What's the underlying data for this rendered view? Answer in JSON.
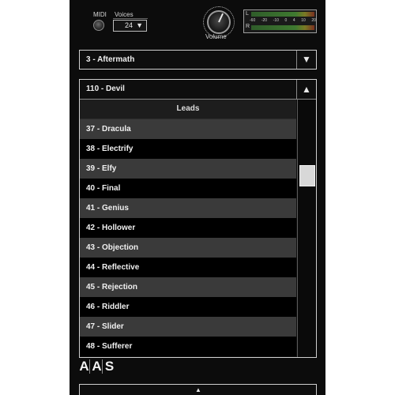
{
  "header": {
    "midi_label": "MIDI",
    "voices_label": "Voices",
    "voices_value": "24",
    "volume_label": "Volume",
    "meter": {
      "left_label": "L",
      "right_label": "R",
      "scale": [
        "-60",
        "-20",
        "-10",
        "0",
        "4",
        "10",
        "20"
      ]
    }
  },
  "bank_select": {
    "value": "3 - Aftermath",
    "arrow_icon": "triangle-down-icon"
  },
  "preset_select": {
    "value": "110 - Devil",
    "arrow_icon": "triangle-up-icon",
    "category": "Leads",
    "items": [
      "37 - Dracula",
      "38 - Electrify",
      "39 - Elfy",
      "40 - Final",
      "41 - Genius",
      "42 - Hollower",
      "43 - Objection",
      "44 - Reflective",
      "45 - Rejection",
      "46 - Riddler",
      "47 - Slider",
      "48 - Sufferer"
    ]
  },
  "logo": {
    "letters": [
      "A",
      "A",
      "S"
    ]
  },
  "colors": {
    "panel_bg": "#0c0c0c",
    "row_odd": "#3a3a3a",
    "row_even": "#000000",
    "text": "#f0f0f0",
    "border": "#cfcfcf"
  }
}
